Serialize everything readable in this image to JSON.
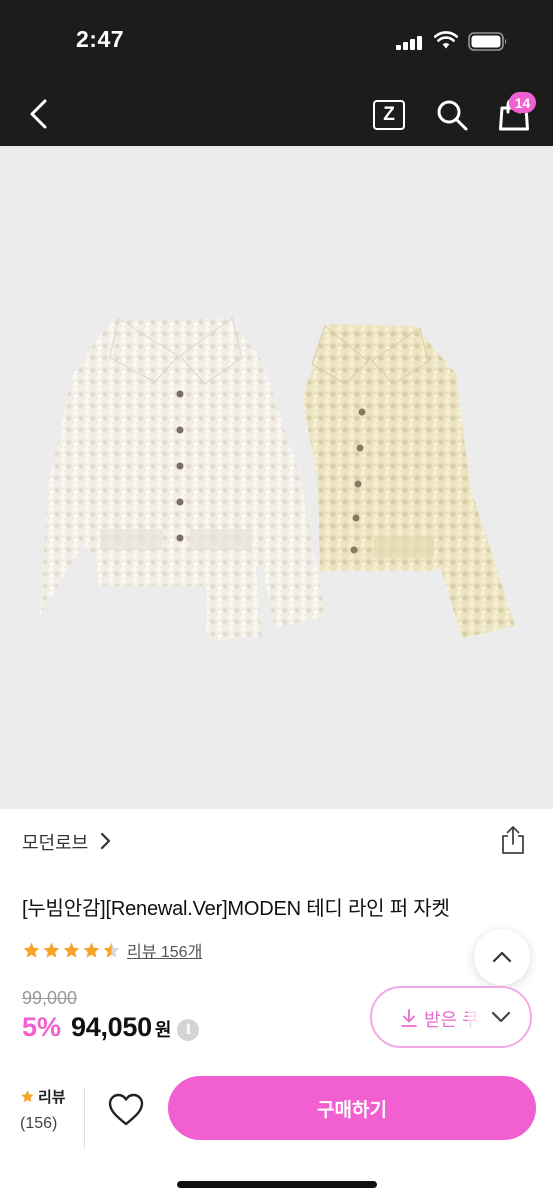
{
  "status_bar": {
    "time": "2:47"
  },
  "nav": {
    "z_label": "Z",
    "cart_count": "14"
  },
  "product": {
    "brand": "모던로브",
    "title": "[누빔안감][Renewal.Ver]MODEN 테디 라인 퍼 자켓",
    "rating_stars": 4.5,
    "review_link": "리뷰 156개",
    "original_price": "99,000",
    "discount": "5%",
    "price": "94,050",
    "currency": "원",
    "info_icon": "i"
  },
  "coupon": {
    "label": "받은 쿠"
  },
  "bottom_bar": {
    "review_label": "리뷰",
    "review_count": "(156)",
    "buy_label": "구매하기"
  },
  "colors": {
    "accent": "#f25fd0",
    "star": "#f6a32c",
    "top_bar": "#1c1c1c",
    "image_bg": "#ececec"
  },
  "icons": [
    "signal-icon",
    "wifi-icon",
    "battery-icon",
    "back-icon",
    "z-icon",
    "search-icon",
    "shopping-bag-icon",
    "chevron-right-icon",
    "share-icon",
    "star-icon",
    "chevron-up-icon",
    "download-icon",
    "chevron-down-icon",
    "heart-icon"
  ]
}
